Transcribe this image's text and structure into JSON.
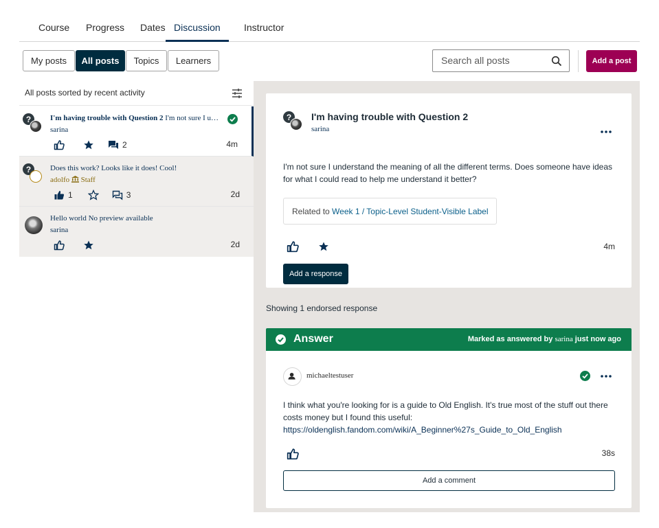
{
  "course_tabs": [
    "Course",
    "Progress",
    "Dates",
    "Discussion",
    "Instructor"
  ],
  "active_course_tab": "Discussion",
  "filters": {
    "my_posts": "My posts",
    "all_posts": "All posts",
    "topics": "Topics",
    "learners": "Learners",
    "active": "All posts"
  },
  "search": {
    "placeholder": "Search all posts"
  },
  "add_post_label": "Add a post",
  "sort_label": "All posts sorted by recent activity",
  "posts": [
    {
      "title": "I'm having trouble with Question 2",
      "preview": "I'm not sure I understand the meaning of all the different terms.",
      "author": "sarina",
      "comments": "2",
      "time": "4m",
      "answered": true
    },
    {
      "title": "Does this work?",
      "preview": "Looks like it does! Cool!",
      "author": "adolfo",
      "role": "Staff",
      "likes": "1",
      "comments": "3",
      "time": "2d"
    },
    {
      "title": "Hello world",
      "preview": "No preview available",
      "author": "sarina",
      "time": "2d"
    }
  ],
  "thread": {
    "title": "I'm having trouble with Question 2",
    "author": "sarina",
    "body": "I'm not sure I understand the meaning of all the different terms. Does someone have ideas for what I could read to help me understand it better?",
    "related_prefix": "Related to",
    "related_topic": "Week 1 / Topic-Level Student-Visible Label",
    "time": "4m",
    "add_response_label": "Add a response"
  },
  "endorsed_label": "Showing 1 endorsed response",
  "answer": {
    "header": "Answer",
    "marked_prefix": "Marked as answered by",
    "marked_by": "sarina",
    "marked_suffix": "just now ago",
    "author": "michaeltestuser",
    "body": "I think what you're looking for is a guide to Old English. It's true most of the stuff out there costs money but I found this useful:",
    "link": "https://oldenglish.fandom.com/wiki/A_Beginner%27s_Guide_to_Old_English",
    "time": "38s",
    "add_comment_label": "Add a comment"
  },
  "colors": {
    "primary": "#002c3f",
    "brand": "#9d0054",
    "success": "#0d7d4d",
    "panel_bg": "#e7e4e1"
  }
}
